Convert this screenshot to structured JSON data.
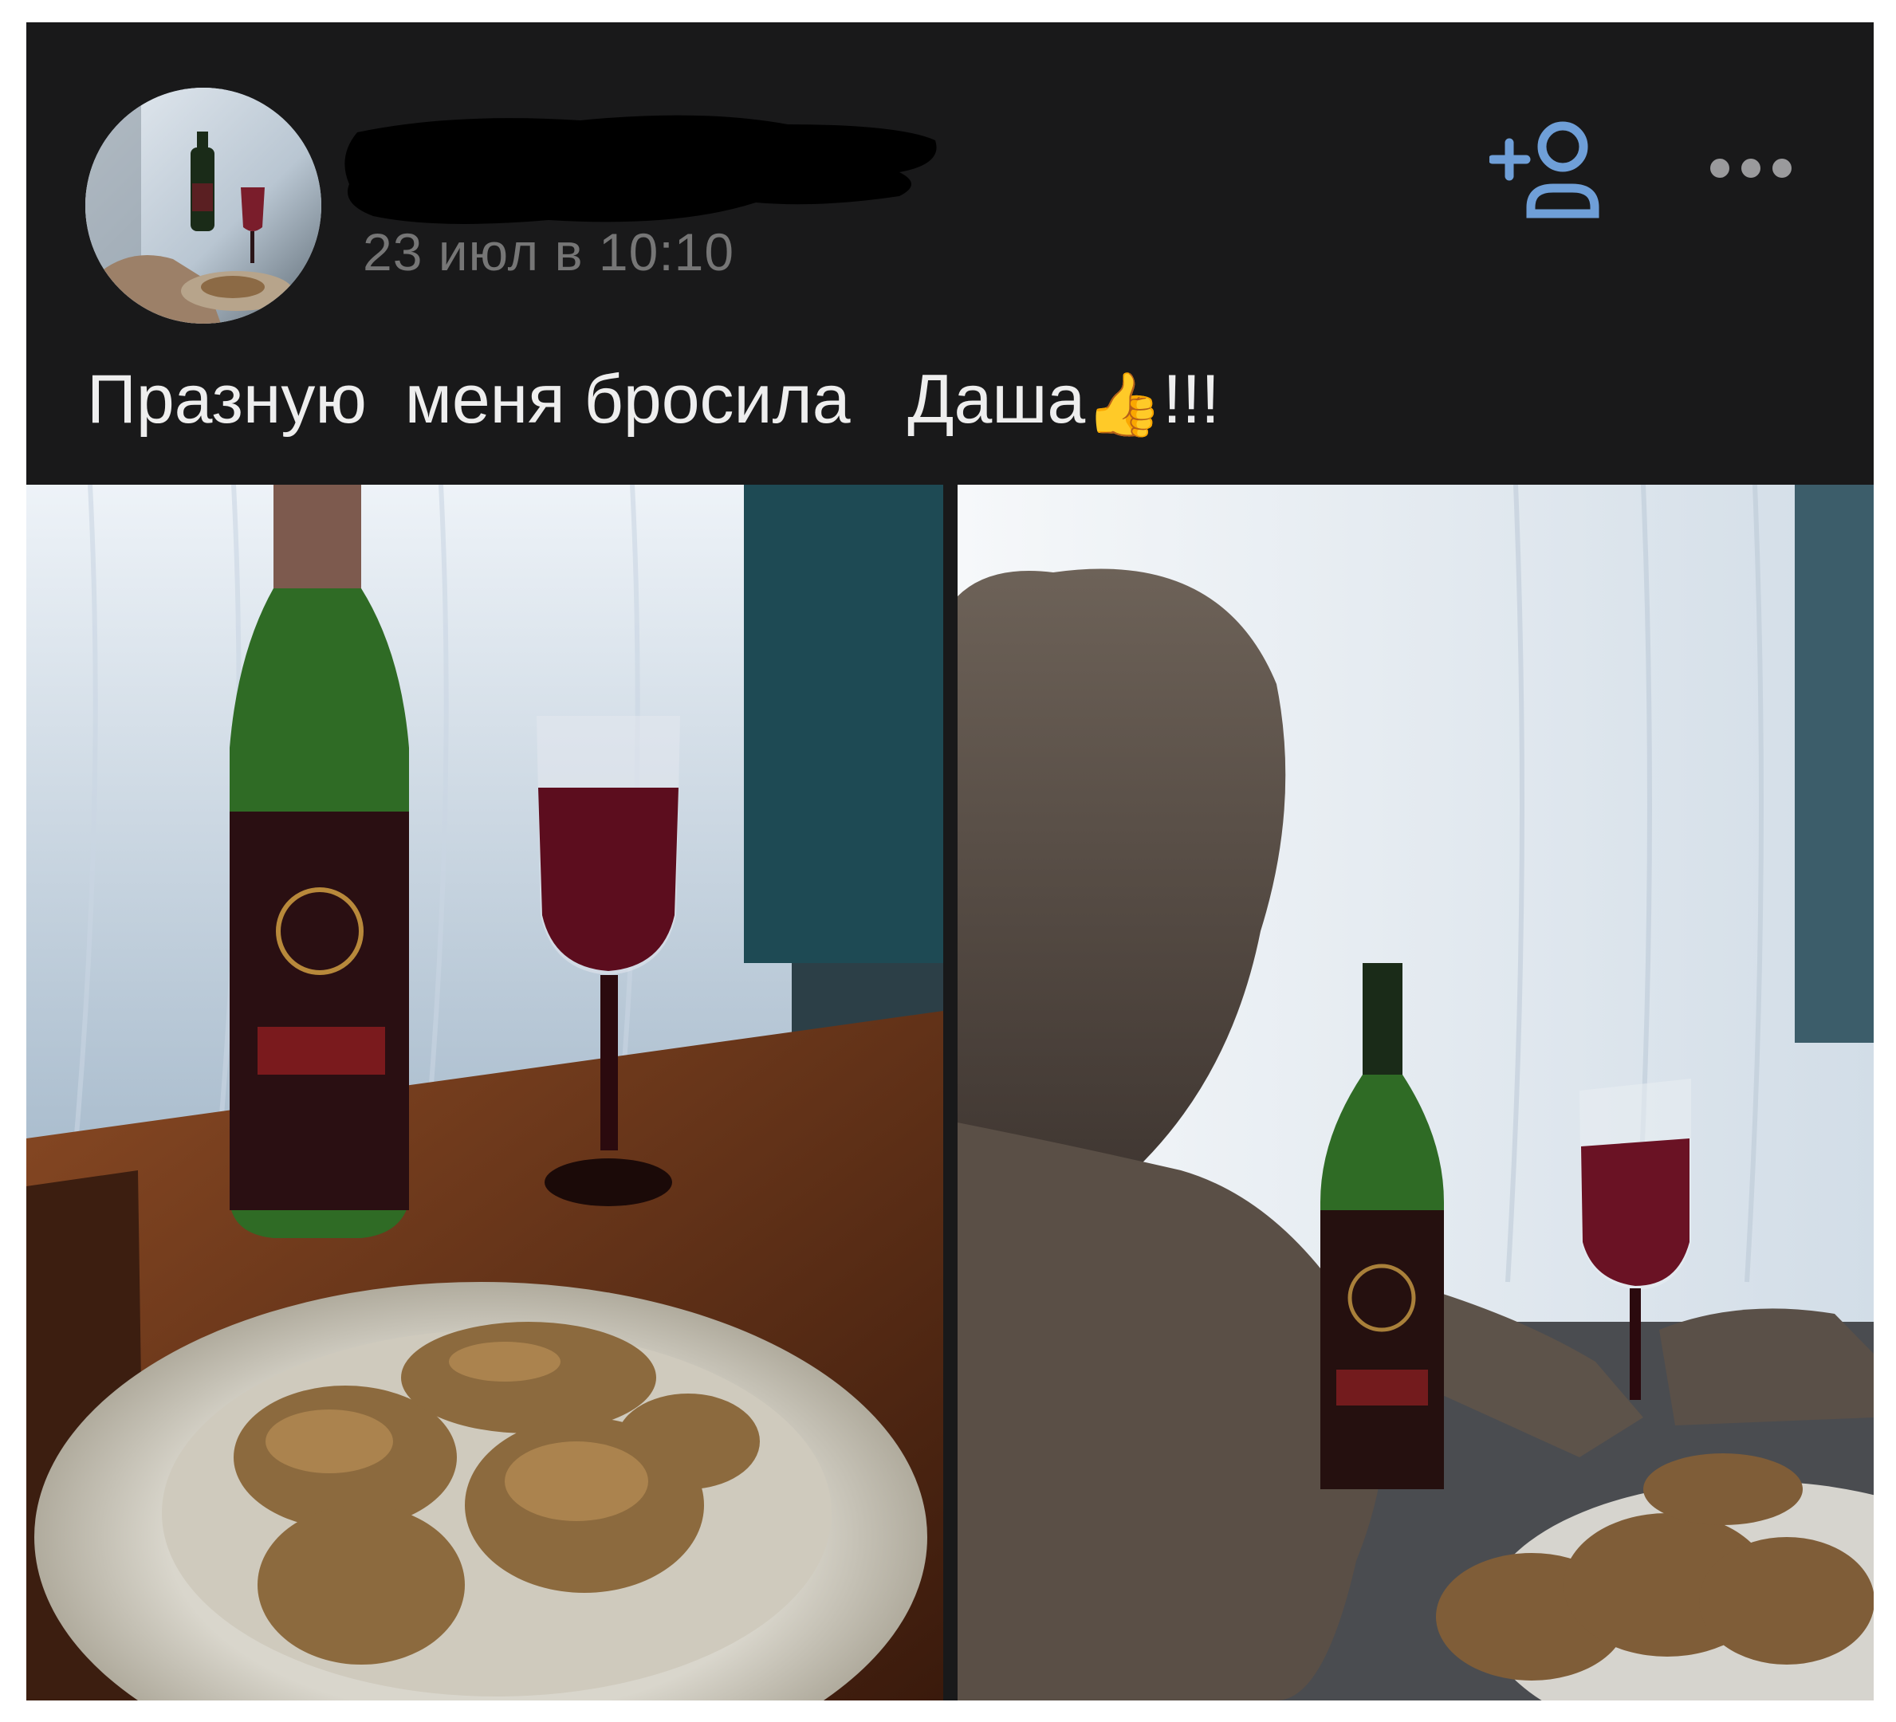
{
  "post": {
    "author_name": "",
    "timestamp": "23 июл в 10:10",
    "text_part1": "Празную  меня бросила   Даша",
    "emoji": "👍",
    "text_part2": "!!!",
    "icons": {
      "add_friend": "add-friend-icon",
      "more": "more-icon"
    },
    "colors": {
      "background": "#19191a",
      "text": "#eeeeee",
      "timestamp": "#767676",
      "accent": "#6f9fd8"
    }
  },
  "photos": [
    {
      "label": "Wine bottle, glass of wine and plate of roasted chicken on a table"
    },
    {
      "label": "Man posing with wine bottle, glass of wine and chicken by a window"
    }
  ]
}
